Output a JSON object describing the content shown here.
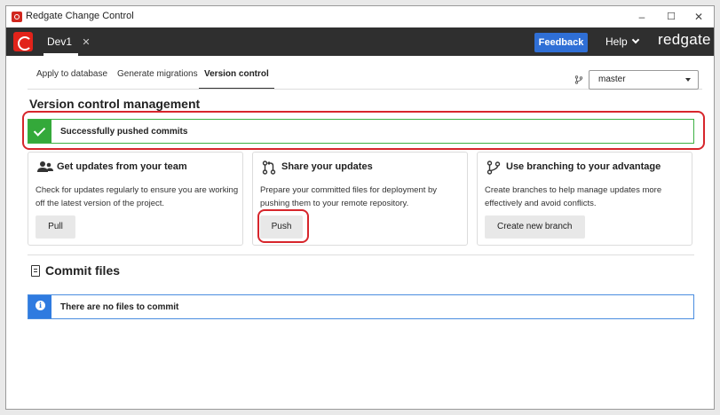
{
  "window": {
    "title": "Redgate Change Control",
    "controls": {
      "minimize": "–",
      "maximize": "☐",
      "close": "✕"
    }
  },
  "appbar": {
    "database_tab": "Dev1",
    "close_tab": "✕",
    "feedback_label": "Feedback",
    "help_label": "Help",
    "brand": "redgate"
  },
  "tabs": [
    {
      "label": "Apply to database",
      "active": false
    },
    {
      "label": "Generate migrations",
      "active": false
    },
    {
      "label": "Version control",
      "active": true
    }
  ],
  "branch": {
    "icon": "branch-icon",
    "value": "master"
  },
  "page_title": "Version control management",
  "success_banner": {
    "message": "Successfully pushed commits",
    "icon": "checkmark-icon",
    "color": "#34a93a"
  },
  "cards": [
    {
      "icon": "team-icon",
      "title": "Get updates from your team",
      "description": "Check for updates regularly to ensure you are working off the latest version of the project.",
      "button": "Pull"
    },
    {
      "icon": "pull-request-icon",
      "title": "Share your updates",
      "description": "Prepare your committed files for deployment by pushing them to your remote repository.",
      "button": "Push"
    },
    {
      "icon": "branch-icon",
      "title": "Use branching to your advantage",
      "description": "Create branches to help manage updates more effectively and avoid conflicts.",
      "button": "Create new branch"
    }
  ],
  "commit_section": {
    "title": "Commit files",
    "icon": "document-icon"
  },
  "info_banner": {
    "message": "There are no files to commit",
    "icon": "info-icon",
    "color": "#2f7be0"
  },
  "colors": {
    "accent": "#2f6fd6",
    "highlight": "#d7262c",
    "appbar": "#2f2f2f",
    "brand_red": "#e2231a"
  }
}
